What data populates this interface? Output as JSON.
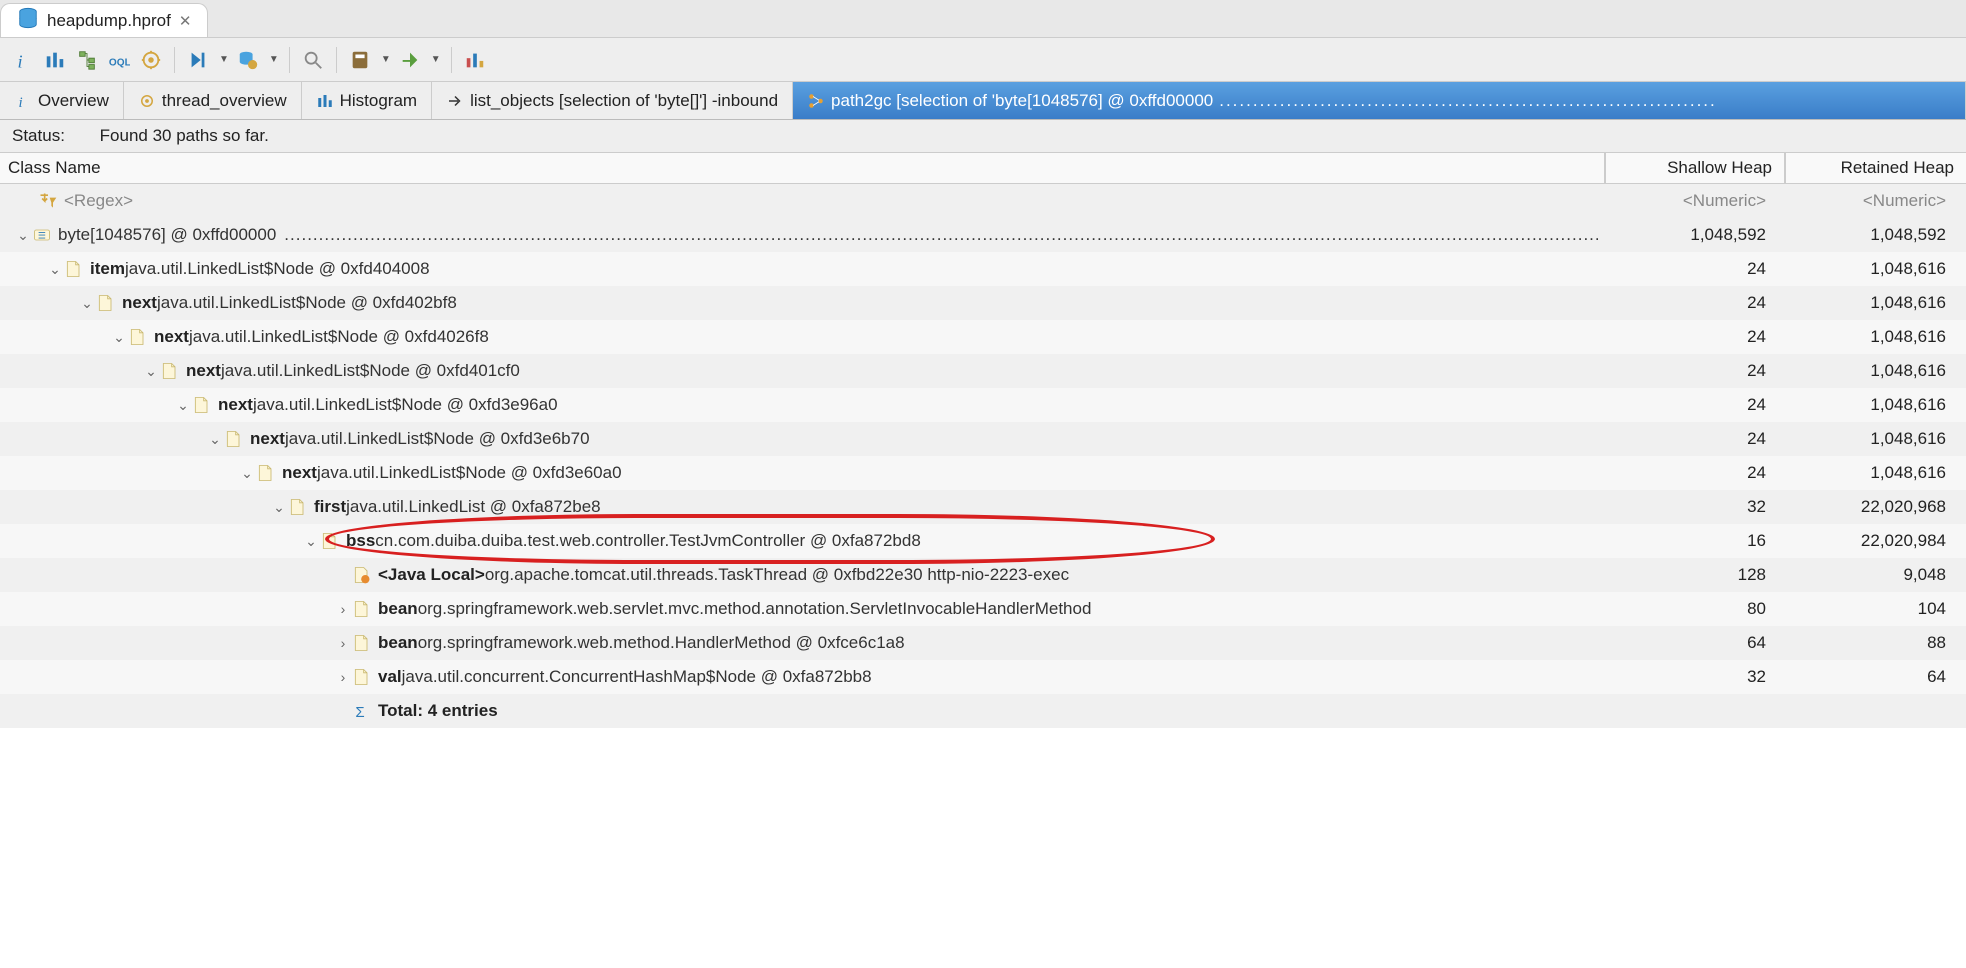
{
  "editor": {
    "title": "heapdump.hprof"
  },
  "tabs": [
    {
      "label": "Overview",
      "icon": "info"
    },
    {
      "label": "thread_overview",
      "icon": "gear"
    },
    {
      "label": "Histogram",
      "icon": "bars"
    },
    {
      "label": "list_objects  [selection of 'byte[]'] -inbound",
      "icon": "arrow"
    },
    {
      "label": "path2gc  [selection of 'byte[1048576] @ 0xffd00000",
      "icon": "tree",
      "active": true
    }
  ],
  "status": {
    "label": "Status:",
    "text": "Found 30 paths so far."
  },
  "columns": {
    "name": "Class Name",
    "shallow": "Shallow Heap",
    "retained": "Retained Heap"
  },
  "regex_placeholder": "<Regex>",
  "numeric_placeholder": "<Numeric>",
  "rows": [
    {
      "indent": 0,
      "expander": "⌄",
      "icon": "array",
      "bold": "",
      "rest": "byte[1048576] @ 0xffd00000",
      "shallow": "1,048,592",
      "retained": "1,048,592",
      "fill": true
    },
    {
      "indent": 1,
      "expander": "⌄",
      "icon": "file",
      "bold": "item",
      "rest": " java.util.LinkedList$Node @ 0xfd404008",
      "shallow": "24",
      "retained": "1,048,616"
    },
    {
      "indent": 2,
      "expander": "⌄",
      "icon": "file",
      "bold": "next",
      "rest": " java.util.LinkedList$Node @ 0xfd402bf8",
      "shallow": "24",
      "retained": "1,048,616"
    },
    {
      "indent": 3,
      "expander": "⌄",
      "icon": "file",
      "bold": "next",
      "rest": " java.util.LinkedList$Node @ 0xfd4026f8",
      "shallow": "24",
      "retained": "1,048,616"
    },
    {
      "indent": 4,
      "expander": "⌄",
      "icon": "file",
      "bold": "next",
      "rest": " java.util.LinkedList$Node @ 0xfd401cf0",
      "shallow": "24",
      "retained": "1,048,616"
    },
    {
      "indent": 5,
      "expander": "⌄",
      "icon": "file",
      "bold": "next",
      "rest": " java.util.LinkedList$Node @ 0xfd3e96a0",
      "shallow": "24",
      "retained": "1,048,616"
    },
    {
      "indent": 6,
      "expander": "⌄",
      "icon": "file",
      "bold": "next",
      "rest": " java.util.LinkedList$Node @ 0xfd3e6b70",
      "shallow": "24",
      "retained": "1,048,616"
    },
    {
      "indent": 7,
      "expander": "⌄",
      "icon": "file",
      "bold": "next",
      "rest": " java.util.LinkedList$Node @ 0xfd3e60a0",
      "shallow": "24",
      "retained": "1,048,616"
    },
    {
      "indent": 8,
      "expander": "⌄",
      "icon": "file",
      "bold": "first",
      "rest": " java.util.LinkedList @ 0xfa872be8",
      "shallow": "32",
      "retained": "22,020,968"
    },
    {
      "indent": 9,
      "expander": "⌄",
      "icon": "file",
      "bold": "bss",
      "rest": " cn.com.duiba.duiba.test.web.controller.TestJvmController @ 0xfa872bd8",
      "shallow": "16",
      "retained": "22,020,984",
      "circled": true
    },
    {
      "indent": 10,
      "expander": "",
      "icon": "gcroot",
      "bold": "<Java Local>",
      "rest": " org.apache.tomcat.util.threads.TaskThread @ 0xfbd22e30  http-nio-2223-exec",
      "shallow": "128",
      "retained": "9,048"
    },
    {
      "indent": 10,
      "expander": "›",
      "icon": "file",
      "bold": "bean",
      "rest": " org.springframework.web.servlet.mvc.method.annotation.ServletInvocableHandlerMethod",
      "shallow": "80",
      "retained": "104"
    },
    {
      "indent": 10,
      "expander": "›",
      "icon": "file",
      "bold": "bean",
      "rest": " org.springframework.web.method.HandlerMethod @ 0xfce6c1a8",
      "shallow": "64",
      "retained": "88"
    },
    {
      "indent": 10,
      "expander": "›",
      "icon": "file",
      "bold": "val",
      "rest": " java.util.concurrent.ConcurrentHashMap$Node @ 0xfa872bb8",
      "shallow": "32",
      "retained": "64"
    },
    {
      "indent": 10,
      "expander": "",
      "icon": "sigma",
      "bold": "Total: 4 entries",
      "rest": "",
      "shallow": "",
      "retained": ""
    }
  ]
}
